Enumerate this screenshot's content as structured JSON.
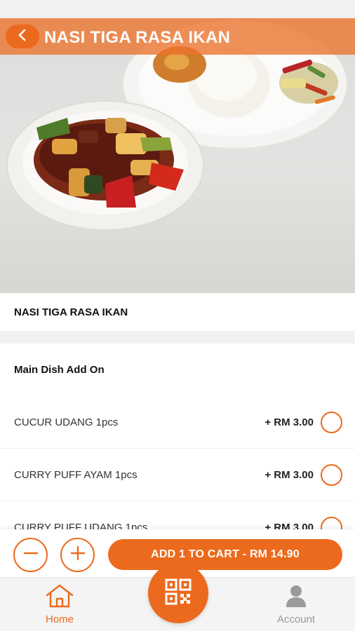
{
  "header": {
    "title": "NASI TIGA RASA IKAN"
  },
  "product": {
    "name": "NASI TIGA RASA IKAN"
  },
  "addons": {
    "heading": "Main Dish Add On",
    "items": [
      {
        "name": "CUCUR UDANG 1pcs",
        "price": "+ RM 3.00"
      },
      {
        "name": "CURRY PUFF AYAM 1pcs",
        "price": "+ RM 3.00"
      },
      {
        "name": "CURRY PUFF UDANG 1pcs",
        "price": "+ RM 3.00"
      }
    ]
  },
  "cart": {
    "button_label": "ADD 1 TO CART - RM 14.90"
  },
  "nav": {
    "home_label": "Home",
    "account_label": "Account"
  },
  "colors": {
    "accent": "#EC6A1D",
    "inactive": "#9A9A9A"
  },
  "icons": [
    "chevron-left-icon",
    "minus-icon",
    "plus-icon",
    "home-icon",
    "qr-code-icon",
    "account-icon"
  ]
}
